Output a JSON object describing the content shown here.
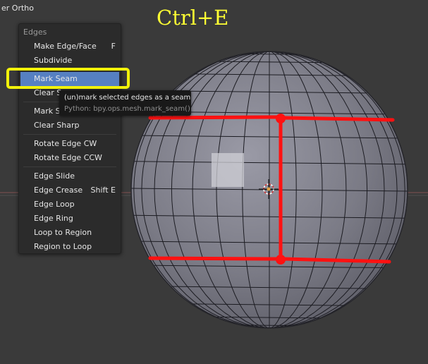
{
  "viewport": {
    "label": "er Ortho"
  },
  "annotation": {
    "shortcut": "Ctrl+E",
    "accent_color": "#ff1111",
    "highlight_color": "#f2f20a"
  },
  "menu": {
    "title": "Edges",
    "groups": [
      [
        {
          "label": "Make Edge/Face",
          "key": "F"
        },
        {
          "label": "Subdivide",
          "key": ""
        }
      ],
      [
        {
          "label": "Mark Seam",
          "key": "",
          "active": true
        },
        {
          "label": "Clear S",
          "key": ""
        }
      ],
      [
        {
          "label": "Mark S",
          "key": ""
        },
        {
          "label": "Clear Sharp",
          "key": ""
        }
      ],
      [
        {
          "label": "Rotate Edge CW",
          "key": ""
        },
        {
          "label": "Rotate Edge CCW",
          "key": ""
        }
      ],
      [
        {
          "label": "Edge Slide",
          "key": ""
        },
        {
          "label": "Edge Crease",
          "key": "Shift E"
        },
        {
          "label": "Edge Loop",
          "key": ""
        },
        {
          "label": "Edge Ring",
          "key": ""
        },
        {
          "label": "Loop to Region",
          "key": ""
        },
        {
          "label": "Region to Loop",
          "key": ""
        }
      ]
    ]
  },
  "tooltip": {
    "text": "(un)mark selected edges as a seam",
    "python": "Python: bpy.ops.mesh.mark_seam()"
  }
}
